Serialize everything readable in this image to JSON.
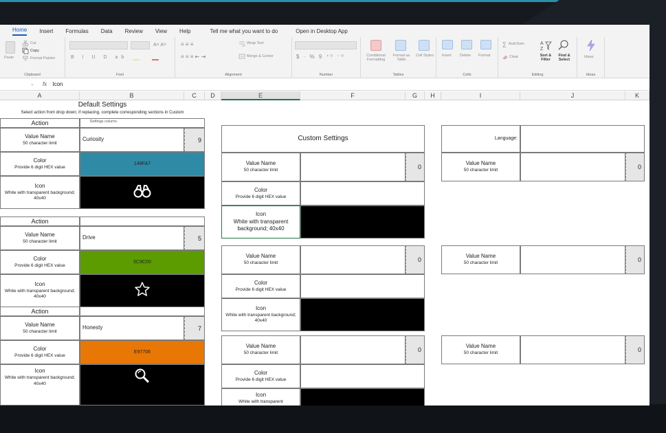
{
  "menu": {
    "items": [
      "Home",
      "Insert",
      "Formulas",
      "Data",
      "Review",
      "View",
      "Help",
      "Tell me what you want to do",
      "Open in Desktop App"
    ]
  },
  "ribbon": {
    "clipboard": {
      "paste": "Paste",
      "cut": "Cut",
      "copy": "Copy",
      "format_painter": "Format Painter",
      "label": "Clipboard"
    },
    "font": {
      "label": "Font"
    },
    "alignment": {
      "wrap": "Wrap Text",
      "merge": "Merge & Center",
      "label": "Alignment"
    },
    "number": {
      "label": "Number"
    },
    "tables": {
      "conditional": "Conditional Formatting",
      "format_table": "Format as Table",
      "cell_styles": "Cell Styles",
      "label": "Tables"
    },
    "cells": {
      "insert": "Insert",
      "delete": "Delete",
      "format": "Format",
      "label": "Cells"
    },
    "editing": {
      "autosum": "AutoSum",
      "clear": "Clear",
      "sort": "Sort & Filter",
      "find": "Find & Select",
      "label": "Editing"
    },
    "ideas": {
      "ideas": "Ideas",
      "label": "Ideas"
    }
  },
  "formula_bar": {
    "fx": "fx",
    "value": "Icon"
  },
  "columns": [
    "A",
    "B",
    "C",
    "D",
    "E",
    "F",
    "G",
    "H",
    "I",
    "J",
    "K"
  ],
  "default_settings": {
    "title": "Default Settings",
    "instructions": "Select action from drop down; if replacing, complete corresponding sections in Custom Settings column.",
    "action_label": "Action",
    "value_name_label": "Value Name",
    "value_name_sub": "50 character limit",
    "color_label": "Color",
    "color_sub": "Provide 6 digit HEX value",
    "icon_label": "Icon",
    "icon_sub": "White with transparent background; 40x40",
    "blocks": [
      {
        "value": "Curiosity",
        "count": "9",
        "hex": "148FA7",
        "color": "#2f8aa6",
        "icon": "binoculars-icon"
      },
      {
        "value": "Drive",
        "count": "5",
        "hex": "5C9C00",
        "color": "#5c9c00",
        "icon": "star-icon"
      },
      {
        "value": "Honesty",
        "count": "7",
        "hex": "E97706",
        "color": "#e97706",
        "icon": "magnifier-icon"
      }
    ]
  },
  "custom_settings": {
    "title": "Custom Settings",
    "value_name_label": "Value Name",
    "value_name_sub": "50 character limit",
    "color_label": "Color",
    "color_sub": "Provide 6 digit HEX value",
    "icon_label": "Icon",
    "icon_sub_short": "White with transparent",
    "icon_sub": "White with transparent background; 40x40",
    "blocks": [
      {
        "count": "0"
      },
      {
        "count": "0"
      },
      {
        "count": "0"
      }
    ]
  },
  "language": {
    "label": "Language:",
    "value_name_label": "Value Name",
    "value_name_sub": "50 character limit",
    "blocks": [
      {
        "count": "0"
      },
      {
        "count": "0"
      },
      {
        "count": "0"
      }
    ]
  }
}
